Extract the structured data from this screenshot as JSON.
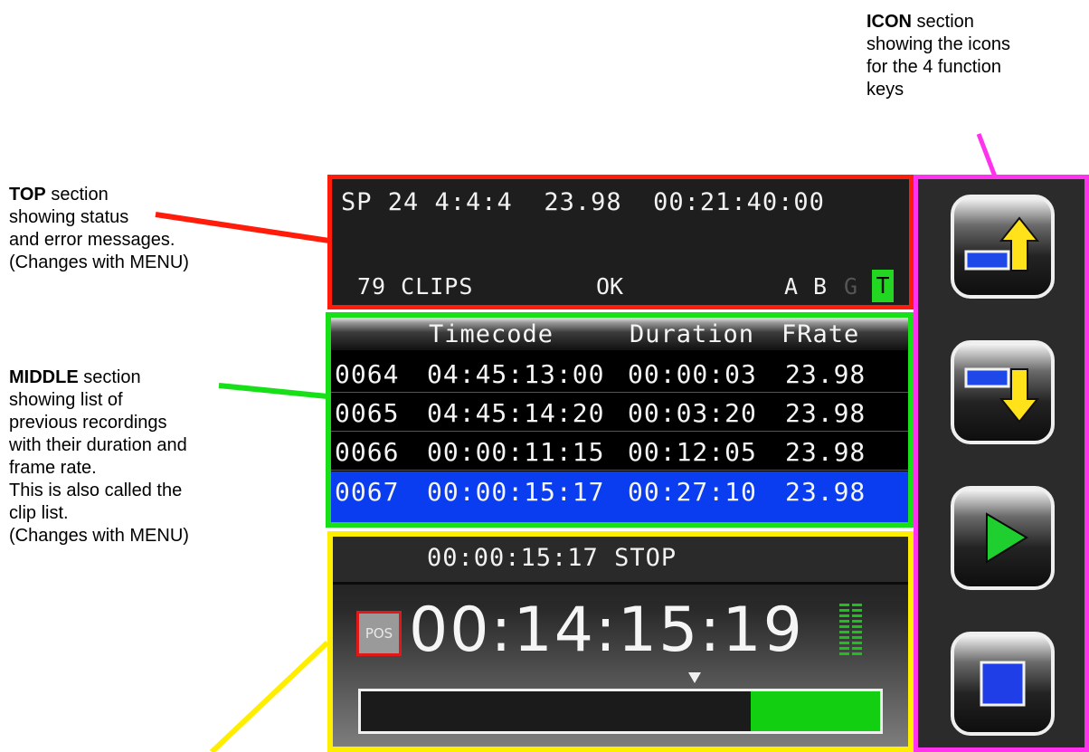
{
  "annotations": {
    "icon": {
      "title": "ICON",
      "lines": [
        " section",
        "showing the icons",
        "for the 4 function",
        "keys"
      ]
    },
    "top": {
      "title": "TOP",
      "lines": [
        " section",
        "showing status",
        "and error messages.",
        "(Changes with MENU)"
      ]
    },
    "middle": {
      "title": "MIDDLE",
      "lines": [
        " section",
        "showing list of",
        "previous recordings",
        "with their duration and",
        "frame rate.",
        "This is also called the",
        "clip list.",
        "(Changes with MENU)"
      ]
    }
  },
  "section_colors": {
    "top": "#ff1c0a",
    "middle": "#18e018",
    "bottom": "#ffee00",
    "icon": "#ff33ee"
  },
  "top": {
    "status_line": "SP 24 4:4:4  23.98  00:21:40:00",
    "clips": "79 CLIPS",
    "message": "OK",
    "channels": [
      "A",
      "B",
      "G",
      "T"
    ],
    "active_channel_color": "#22d622"
  },
  "clip_list": {
    "headers": [
      "Timecode",
      "Duration",
      "FRate"
    ],
    "rows": [
      {
        "id": "0064",
        "timecode": "04:45:13:00",
        "duration": "00:00:03",
        "frate": "23.98",
        "selected": false
      },
      {
        "id": "0065",
        "timecode": "04:45:14:20",
        "duration": "00:03:20",
        "frate": "23.98",
        "selected": false
      },
      {
        "id": "0066",
        "timecode": "00:00:11:15",
        "duration": "00:12:05",
        "frate": "23.98",
        "selected": false
      },
      {
        "id": "0067",
        "timecode": "00:00:15:17",
        "duration": "00:27:10",
        "frate": "23.98",
        "selected": true
      }
    ],
    "selected_color": "#0a3df0"
  },
  "bottom": {
    "status": "00:00:15:17 STOP",
    "pos_label": "POS",
    "timecode": "00:14:15:19",
    "progress_fill_fraction": 0.25
  },
  "function_keys": [
    {
      "icon": "clip-up-arrow-icon"
    },
    {
      "icon": "clip-down-arrow-icon"
    },
    {
      "icon": "play-icon"
    },
    {
      "icon": "stop-icon"
    }
  ]
}
